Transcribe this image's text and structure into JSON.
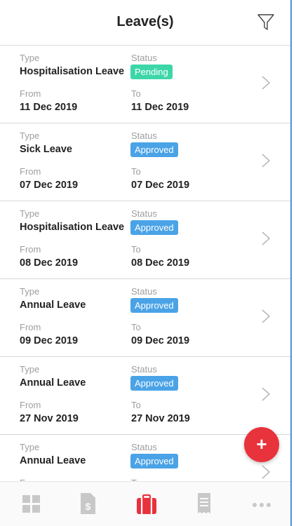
{
  "header": {
    "title": "Leave(s)",
    "filter_icon": "filter-funnel-icon"
  },
  "labels": {
    "type": "Type",
    "status": "Status",
    "from": "From",
    "to": "To"
  },
  "colors": {
    "pending": "#3dd6a8",
    "approved": "#4aa3e6",
    "fab": "#e8323c",
    "active_tab": "#e8323c",
    "inactive_tab": "#c8c8c8"
  },
  "leaves": [
    {
      "type": "Hospitalisation Leave",
      "status": "Pending",
      "from": "11 Dec 2019",
      "to": "11 Dec 2019"
    },
    {
      "type": "Sick Leave",
      "status": "Approved",
      "from": "07 Dec 2019",
      "to": "07 Dec 2019"
    },
    {
      "type": "Hospitalisation Leave",
      "status": "Approved",
      "from": "08 Dec 2019",
      "to": "08 Dec 2019"
    },
    {
      "type": "Annual Leave",
      "status": "Approved",
      "from": "09 Dec 2019",
      "to": "09 Dec 2019"
    },
    {
      "type": "Annual Leave",
      "status": "Approved",
      "from": "27 Nov 2019",
      "to": "27 Nov 2019"
    },
    {
      "type": "Annual Leave",
      "status": "Approved",
      "from": "",
      "to": ""
    }
  ],
  "fab": {
    "label": "+",
    "icon": "plus-icon"
  },
  "tabbar": [
    {
      "icon": "dashboard-grid-icon",
      "active": false
    },
    {
      "icon": "claims-document-dollar-icon",
      "active": false
    },
    {
      "icon": "leave-briefcase-icon",
      "active": true
    },
    {
      "icon": "payslip-receipt-icon",
      "active": false
    },
    {
      "icon": "more-dots-icon",
      "active": false
    }
  ]
}
